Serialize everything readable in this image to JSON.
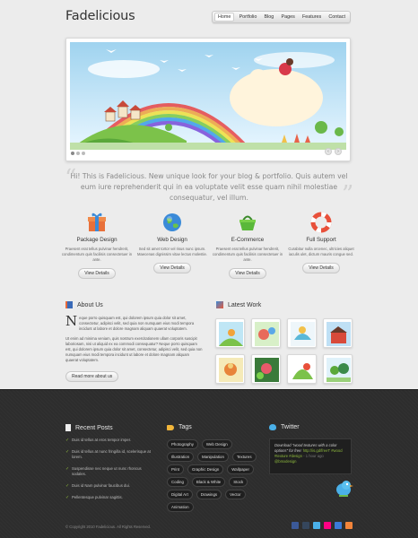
{
  "site": {
    "logo": "Fadelicious"
  },
  "nav": {
    "items": [
      "Home",
      "Portfolio",
      "Blog",
      "Pages",
      "Features",
      "Contact"
    ]
  },
  "intro": {
    "text": "Hi! This is Fadelicious. New unique look for your blog & portfolio. Quis autem vel eum iure reprehenderit qui in ea voluptate velit esse quam nihil molestiae consequatur, vel illum."
  },
  "services": [
    {
      "title": "Package Design",
      "text": "Praesent erat tellus pulvinar hendrerit, condimentum quis facilisis consectetuer in ante.",
      "button": "View Details",
      "icon": "gift-icon"
    },
    {
      "title": "Web Design",
      "text": "Sed sit amet tortor vel risus nunc ipsum. Maecenas dignissim vitae lectus molestie.",
      "button": "View Details",
      "icon": "globe-icon"
    },
    {
      "title": "E-Commerce",
      "text": "Praesent erat tellus pulvinar hendrerit, condimentum quis facilisis consectetuer in ante.",
      "button": "View Details",
      "icon": "basket-icon"
    },
    {
      "title": "Full Support",
      "text": "Curabitur nulla orcenec, ultricies aliquet iaculis ulet, dictum mauris congue sed.",
      "button": "View Details",
      "icon": "lifebuoy-icon"
    }
  ],
  "about": {
    "title": "About Us",
    "dropcap": "N",
    "p1": "eque porro quisquam est, qui dolorem ipsum quia dolor sit amet, consectetur, adipisci velit, sed quia non numquam eius modi tempora incidunt ut labore et dolore magnam aliquam quaerat voluptatem.",
    "p2": "Ut enim ad minima veniam, quis nostrum exercitationem ullam corporis suscipit laboriosam, nisi ut aliquid ex ea commodi consequatur? Neque porro quisquam est, qui dolorem ipsum quia dolor sit amet, consectetur, adipisci velit, sed quia non numquam eius modi tempora incidunt ut labore et dolore magnam aliquam quaerat voluptatem.",
    "button": "Read more about us"
  },
  "work": {
    "title": "Latest Work"
  },
  "footer": {
    "posts_title": "Recent Posts",
    "posts": [
      "Duis id tellus at eros tempor imper.",
      "Duis id tellus at nunc fringilla id, scelerisque at lorem.",
      "Suspendisse nec neque ut nunc rhoncus sodales.",
      "Duis id Nam pulvinar faucibus dui.",
      "Pellentesque pulvinar sagittis."
    ],
    "tags_title": "Tags",
    "tags": [
      "Photography",
      "Web Design",
      "Illustration",
      "Manipulation",
      "Textures",
      "Print",
      "Graphic Design",
      "Wallpaper",
      "Coding",
      "Black & White",
      "Stock",
      "Digital Art",
      "Drawings",
      "Vector",
      "Animation"
    ],
    "twitter_title": "Twitter",
    "tweet": "Download \"wood textures with a color options\" for free: ",
    "tweet_link": "http://is.gd/freeT",
    "tweet_tags": "#wood #texture #design",
    "tweet_time": "- 1 hour ago",
    "tweet_user": "@bmxdesign",
    "copyright": "© Copyright 2010 Fadelicious. All Rights Reserved."
  }
}
